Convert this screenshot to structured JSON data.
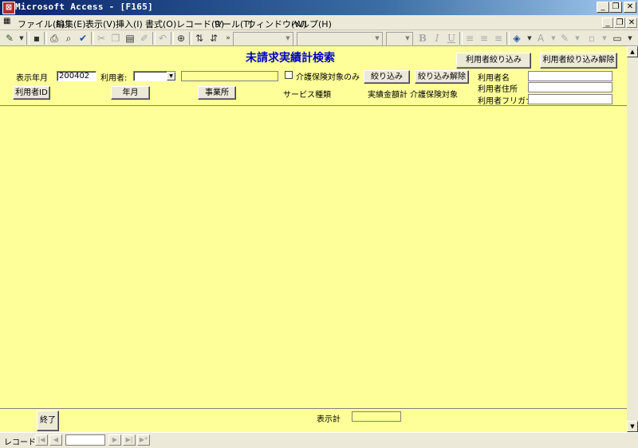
{
  "window": {
    "title": "Microsoft Access - [F165]",
    "app_icon": "access-icon"
  },
  "menu": {
    "items": [
      "ファイル(F)",
      "編集(E)",
      "表示(V)",
      "挿入(I)",
      "書式(O)",
      "レコード(R)",
      "ツール(T)",
      "ウィンドウ(W)",
      "ヘルプ(H)"
    ]
  },
  "form": {
    "title": "未請求実績計検索",
    "display_month_label": "表示年月",
    "display_month_value": "200402",
    "user_label": "利用者:",
    "user_combo_value": "",
    "user_name_value": "",
    "kaigo_only_label": "介護保険対象のみ",
    "filter_button": "絞り込み",
    "filter_clear_button": "絞り込み解除",
    "user_filter_button": "利用者絞り込み",
    "user_filter_clear_button": "利用者絞り込み解除",
    "username_label": "利用者名",
    "address_label": "利用者住所",
    "furigana_label": "利用者フリガナ",
    "sort_user_id_button": "利用者ID",
    "sort_month_button": "年月",
    "sort_office_button": "事業所",
    "service_type_header": "サービス種類",
    "amount_header": "実績金額計",
    "kaigo_target_header": "介護保険対象",
    "close_button": "終了",
    "total_label": "表示計",
    "total_value": ""
  },
  "record_nav": {
    "label": "レコード:",
    "current": ""
  },
  "colors": {
    "form_bg": "#ffff99",
    "title_color": "#0000cc",
    "titlebar": "#0a246a"
  }
}
